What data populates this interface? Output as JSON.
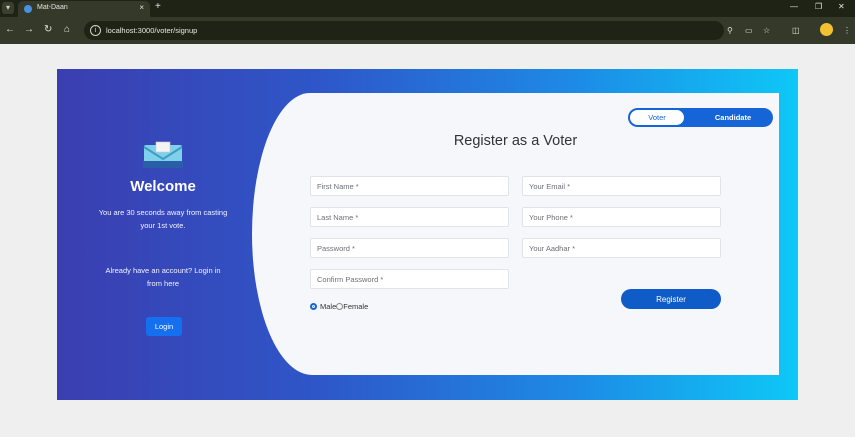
{
  "browser": {
    "tab_title": "Mat-Daan",
    "tab_close": "×",
    "new_tab": "+",
    "url": "localhost:3000/voter/signup",
    "icons": [
      "tab-menu-icon",
      "back-icon",
      "forward-icon",
      "reload-icon",
      "home-icon",
      "site-info-icon",
      "password-key-icon",
      "cast-icon",
      "bookmark-star-icon",
      "extensions-icon",
      "profile-icon",
      "menu-icon",
      "minimize-icon",
      "restore-icon",
      "close-icon"
    ]
  },
  "welcome": {
    "title": "Welcome",
    "subtitle": "You are 30 seconds away from casting your 1st vote.",
    "login_prompt": "Already have an account? Login in from here",
    "login_button": "Login"
  },
  "toggle": {
    "voter": "Voter",
    "candidate": "Candidate",
    "active": "Voter"
  },
  "form": {
    "title": "Register as a Voter",
    "placeholders": {
      "first_name": "First Name *",
      "email": "Your Email *",
      "last_name": "Last Name *",
      "phone": "Your Phone *",
      "password": "Password *",
      "aadhar": "Your Aadhar *",
      "confirm_password": "Confirm Password *"
    },
    "gender": {
      "male": "Male",
      "female": "Female",
      "selected": "Male"
    },
    "register_button": "Register"
  },
  "colors": {
    "gradient_start": "#3b3eb0",
    "gradient_end": "#0ec8f6",
    "primary": "#1565d8",
    "panel_bg": "#f6f7fa"
  }
}
